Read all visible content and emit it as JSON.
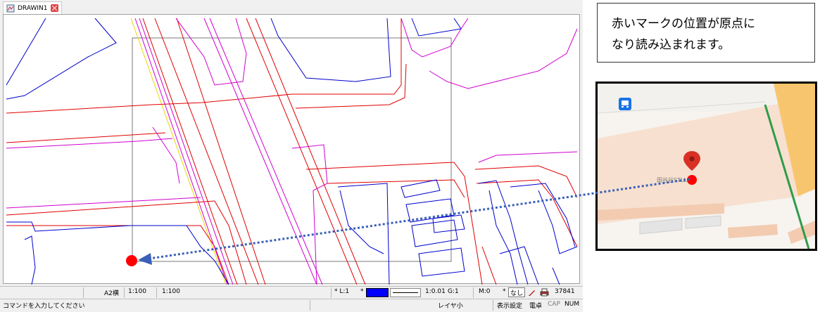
{
  "window": {
    "tab_title": "DRAWIN1"
  },
  "status_bar": {
    "paper_size": "A2横",
    "scale_1": "1:100",
    "scale_2": "1:100",
    "layer_label": "* L:1",
    "color_label": "*",
    "line_scale": "1:0.01",
    "group": "G:1",
    "mode": "M:0",
    "snap_label": "*",
    "snap_value": "なし",
    "count": "37841",
    "accent_color": "#0000ff"
  },
  "command_bar": {
    "prompt": "コマンドを入力してください",
    "layer_mode": "レイヤ小",
    "display_settings": "表示設定",
    "snap_point": "電卓",
    "caps": "CAP",
    "num": "NUM"
  },
  "callout": {
    "line1": "赤いマークの位置が原点に",
    "line2": "なり読み込まれます。"
  },
  "map": {
    "poi_label": "田谷谷STLL",
    "colors": {
      "marker": "#e53935",
      "road": "#f8c56f",
      "rail": "#2e9b4a",
      "building": "#f5d5c0"
    }
  },
  "icons": {
    "tab": "drawing-document-icon",
    "close": "close-icon",
    "bus": "bus-stop-icon",
    "pin": "map-pin-icon",
    "print": "printer-icon",
    "pen": "pen-icon"
  }
}
